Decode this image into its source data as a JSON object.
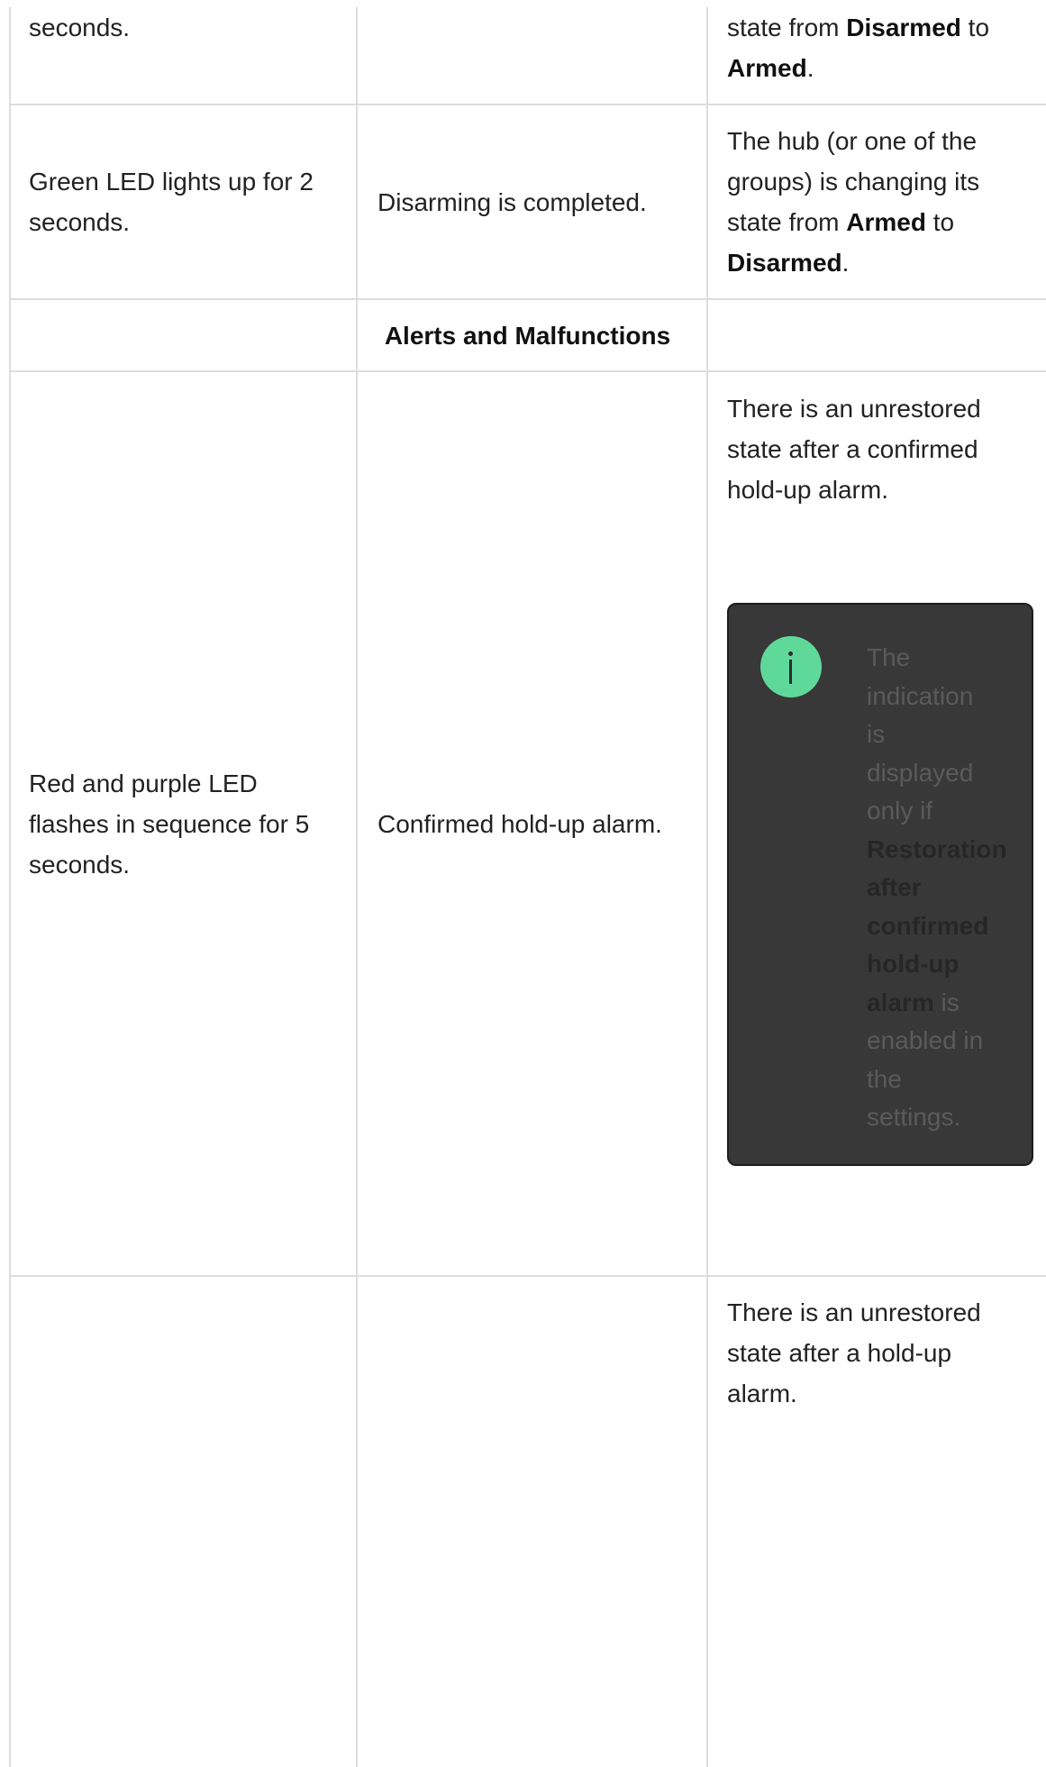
{
  "rows": [
    {
      "col1": "seconds.",
      "col2": "",
      "col3": {
        "pre": "state from ",
        "bold1": "Disarmed",
        "mid": " to",
        "bold2": "Armed",
        "post": "."
      }
    },
    {
      "col1_line1": "Green LED lights up for 2",
      "col1_line2": "seconds.",
      "col2": "Disarming is completed.",
      "col3": {
        "line1": "The hub (or one of the",
        "line2": "groups) is changing its",
        "pre": "state from ",
        "bold1": "Armed",
        "mid": " to",
        "bold2": "Disarmed",
        "post": "."
      }
    }
  ],
  "section": {
    "title": "Alerts and Malfunctions"
  },
  "alert_rows": [
    {
      "col1_line1": "Red and purple LED",
      "col1_line2": "flashes in sequence for 5",
      "col1_line3": "seconds.",
      "col2": "Confirmed hold-up alarm.",
      "col3_line1": "There is an unrestored",
      "col3_line2": "state after a confirmed",
      "col3_line3": "hold-up alarm.",
      "note": {
        "icon": "info-icon",
        "icon_color": "#5fd99a",
        "words_pre": [
          "The",
          "indication",
          "is",
          "displayed",
          "only if"
        ],
        "bold_words": [
          "Restoration",
          "after",
          "confirmed",
          "hold-up",
          "alarm"
        ],
        "post_is": " is",
        "words_post": [
          "enabled in",
          "the",
          "settings."
        ]
      }
    },
    {
      "col3_line1": "There is an unrestored",
      "col3_line2": "state after a hold-up",
      "col3_line3": "alarm."
    }
  ]
}
